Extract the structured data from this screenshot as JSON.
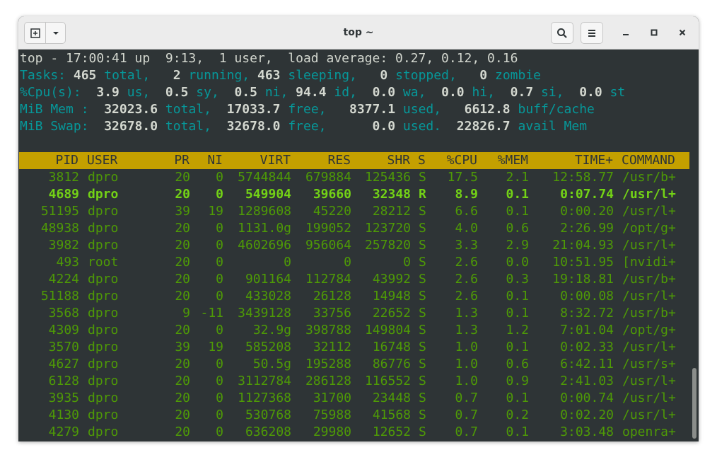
{
  "window": {
    "title": "top ~"
  },
  "icons": {
    "new_tab": "new-tab-icon",
    "dropdown": "chevron-down-icon",
    "search": "search-icon",
    "menu": "hamburger-menu-icon",
    "minimize": "minimize-icon",
    "maximize": "maximize-icon",
    "close": "close-icon"
  },
  "colors": {
    "terminal_bg": "#2e3436",
    "cyan": "#06989a",
    "green": "#4e9a06",
    "bright_green": "#73d216",
    "header_bg": "#c4a000"
  },
  "summary": {
    "line1": "top - 17:00:41 up  9:13,  1 user,  load average: 0.27, 0.12, 0.16",
    "tasks": {
      "label": "Tasks:",
      "total": " 465",
      "total_lbl": " total,",
      "running": "   2",
      "running_lbl": " running,",
      "sleeping": " 463",
      "sleeping_lbl": " sleeping,",
      "stopped": "   0",
      "stopped_lbl": " stopped,",
      "zombie": "   0",
      "zombie_lbl": " zombie"
    },
    "cpu": {
      "label": "%Cpu(s):",
      "us": "  3.9",
      "us_lbl": " us,",
      "sy": "  0.5",
      "sy_lbl": " sy,",
      "ni": "  0.5",
      "ni_lbl": " ni,",
      "id": " 94.4",
      "id_lbl": " id,",
      "wa": "  0.0",
      "wa_lbl": " wa,",
      "hi": "  0.0",
      "hi_lbl": " hi,",
      "si": "  0.7",
      "si_lbl": " si,",
      "st": "  0.0",
      "st_lbl": " st"
    },
    "mem": {
      "label": "MiB Mem :",
      "total": "  32023.6",
      "total_lbl": " total,",
      "free": "  17033.7",
      "free_lbl": " free,",
      "used": "   8377.1",
      "used_lbl": " used,",
      "buff": "   6612.8",
      "buff_lbl": " buff/cache"
    },
    "swap": {
      "label": "MiB Swap:",
      "total": "  32678.0",
      "total_lbl": " total,",
      "free": "  32678.0",
      "free_lbl": " free,",
      "used": "      0.0",
      "used_lbl": " used.",
      "avail": "  22826.7",
      "avail_lbl": " avail Mem"
    }
  },
  "table": {
    "headers": [
      "PID",
      "USER",
      "PR",
      "NI",
      "VIRT",
      "RES",
      "SHR",
      "S",
      "%CPU",
      "%MEM",
      "TIME+",
      "COMMAND"
    ],
    "rows": [
      [
        "3812",
        "dpro",
        "20",
        "0",
        "5744844",
        "679884",
        "125436",
        "S",
        "17.5",
        "2.1",
        "12:58.77",
        "/usr/b+"
      ],
      [
        "4689",
        "dpro",
        "20",
        "0",
        "549904",
        "39660",
        "32348",
        "R",
        "8.9",
        "0.1",
        "0:07.74",
        "/usr/l+"
      ],
      [
        "51195",
        "dpro",
        "39",
        "19",
        "1289608",
        "45220",
        "28212",
        "S",
        "6.6",
        "0.1",
        "0:00.20",
        "/usr/l+"
      ],
      [
        "48938",
        "dpro",
        "20",
        "0",
        "1131.0g",
        "199052",
        "123720",
        "S",
        "4.0",
        "0.6",
        "2:26.99",
        "/opt/g+"
      ],
      [
        "3982",
        "dpro",
        "20",
        "0",
        "4602696",
        "956064",
        "257820",
        "S",
        "3.3",
        "2.9",
        "21:04.93",
        "/usr/l+"
      ],
      [
        "493",
        "root",
        "20",
        "0",
        "0",
        "0",
        "0",
        "S",
        "2.6",
        "0.0",
        "10:51.95",
        "[nvidi+"
      ],
      [
        "4224",
        "dpro",
        "20",
        "0",
        "901164",
        "112784",
        "43992",
        "S",
        "2.6",
        "0.3",
        "19:18.81",
        "/usr/b+"
      ],
      [
        "51188",
        "dpro",
        "20",
        "0",
        "433028",
        "26128",
        "14948",
        "S",
        "2.6",
        "0.1",
        "0:00.08",
        "/usr/l+"
      ],
      [
        "3568",
        "dpro",
        "9",
        "-11",
        "3439128",
        "33756",
        "22652",
        "S",
        "1.3",
        "0.1",
        "8:32.72",
        "/usr/b+"
      ],
      [
        "4309",
        "dpro",
        "20",
        "0",
        "32.9g",
        "398788",
        "149804",
        "S",
        "1.3",
        "1.2",
        "7:01.04",
        "/opt/g+"
      ],
      [
        "3570",
        "dpro",
        "39",
        "19",
        "585208",
        "32112",
        "16748",
        "S",
        "1.0",
        "0.1",
        "0:02.33",
        "/usr/l+"
      ],
      [
        "4627",
        "dpro",
        "20",
        "0",
        "50.5g",
        "195288",
        "86776",
        "S",
        "1.0",
        "0.6",
        "6:42.11",
        "/usr/s+"
      ],
      [
        "6128",
        "dpro",
        "20",
        "0",
        "3112784",
        "286128",
        "116552",
        "S",
        "1.0",
        "0.9",
        "2:41.03",
        "/usr/l+"
      ],
      [
        "3935",
        "dpro",
        "20",
        "0",
        "1127368",
        "31700",
        "23448",
        "S",
        "0.7",
        "0.1",
        "0:00.74",
        "/usr/l+"
      ],
      [
        "4130",
        "dpro",
        "20",
        "0",
        "530768",
        "75988",
        "41568",
        "S",
        "0.7",
        "0.2",
        "0:02.20",
        "/usr/l+"
      ],
      [
        "4279",
        "dpro",
        "20",
        "0",
        "636208",
        "29980",
        "12652",
        "S",
        "0.7",
        "0.1",
        "3:03.48",
        "openra+"
      ]
    ],
    "bold_row_index": 1
  }
}
